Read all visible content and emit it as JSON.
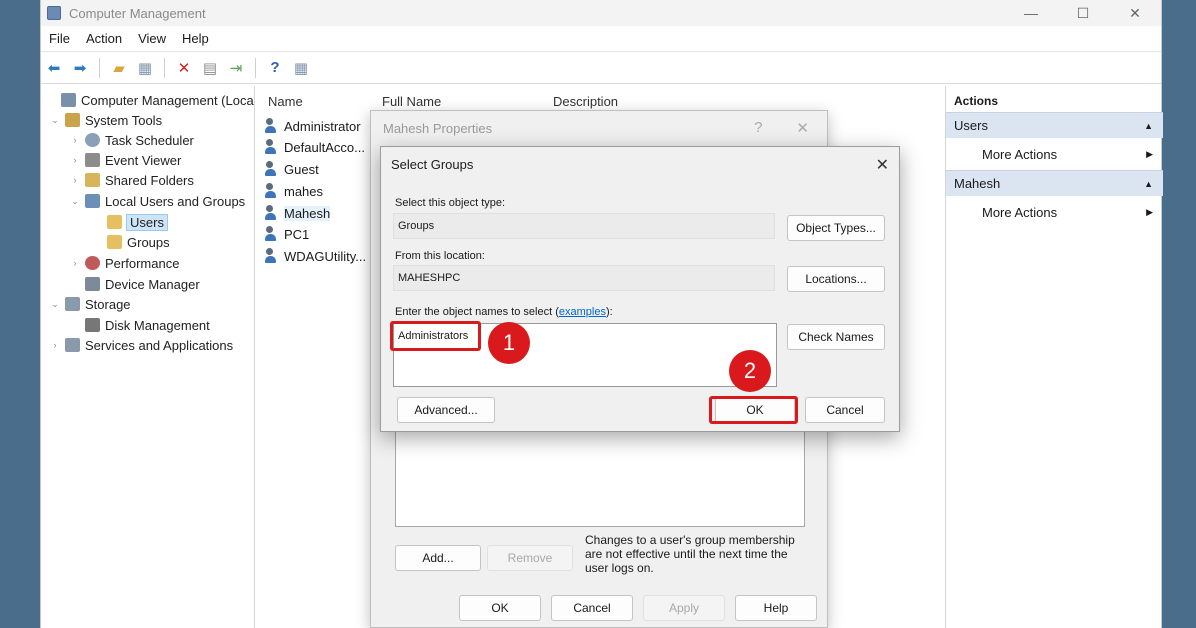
{
  "window": {
    "title": "Computer Management",
    "controls": [
      "—",
      "☐",
      "✕"
    ]
  },
  "menu": [
    "File",
    "Action",
    "View",
    "Help"
  ],
  "tree": [
    {
      "label": "Computer Management (Local)",
      "expander": "",
      "color": "#7a8fa8"
    },
    {
      "label": "System Tools",
      "expander": "⌄",
      "color": "#c9a44a"
    },
    {
      "label": "Task Scheduler",
      "expander": "›",
      "color": "#8aa0b8"
    },
    {
      "label": "Event Viewer",
      "expander": "›",
      "color": "#8c8c8c"
    },
    {
      "label": "Shared Folders",
      "expander": "›",
      "color": "#d8b45a"
    },
    {
      "label": "Local Users and Groups",
      "expander": "⌄",
      "color": "#6c8fb8"
    },
    {
      "label": "Users",
      "expander": "",
      "color": "#e6c060"
    },
    {
      "label": "Groups",
      "expander": "",
      "color": "#e6c060"
    },
    {
      "label": "Performance",
      "expander": "›",
      "color": "#c05a5a"
    },
    {
      "label": "Device Manager",
      "expander": "",
      "color": "#7d8a99"
    },
    {
      "label": "Storage",
      "expander": "⌄",
      "color": "#8a9aaa"
    },
    {
      "label": "Disk Management",
      "expander": "",
      "color": "#777777"
    },
    {
      "label": "Services and Applications",
      "expander": "›",
      "color": "#8a9aaa"
    }
  ],
  "list": {
    "columns": [
      "Name",
      "Full Name",
      "Description"
    ],
    "rows": [
      "Administrator",
      "DefaultAcco...",
      "Guest",
      "mahes",
      "Mahesh",
      "PC1",
      "WDAGUtility..."
    ]
  },
  "actions": {
    "title": "Actions",
    "sections": [
      {
        "label": "Users",
        "item": "More Actions"
      },
      {
        "label": "Mahesh",
        "item": "More Actions"
      }
    ]
  },
  "properties_dialog": {
    "title": "Mahesh Properties",
    "controls": [
      "?",
      "✕"
    ],
    "add_label": "Add...",
    "remove_label": "Remove",
    "note": "Changes to a user's group membership are not effective until the next time the user logs on.",
    "ok_label": "OK",
    "cancel_label": "Cancel",
    "apply_label": "Apply",
    "help_label": "Help"
  },
  "select_groups": {
    "title": "Select Groups",
    "object_type_label": "Select this object type:",
    "object_type_value": "Groups",
    "object_types_button": "Object Types...",
    "location_label": "From this location:",
    "location_value": "MAHESHPC",
    "locations_button": "Locations...",
    "names_label": "Enter the object names to select (",
    "names_link": "examples",
    "names_label_end": "):",
    "names_value": "Administrators",
    "check_names_button": "Check Names",
    "advanced_button": "Advanced...",
    "ok_button": "OK",
    "cancel_button": "Cancel"
  },
  "annotations": {
    "step1": "1",
    "step2": "2",
    "color": "#d9191b"
  }
}
